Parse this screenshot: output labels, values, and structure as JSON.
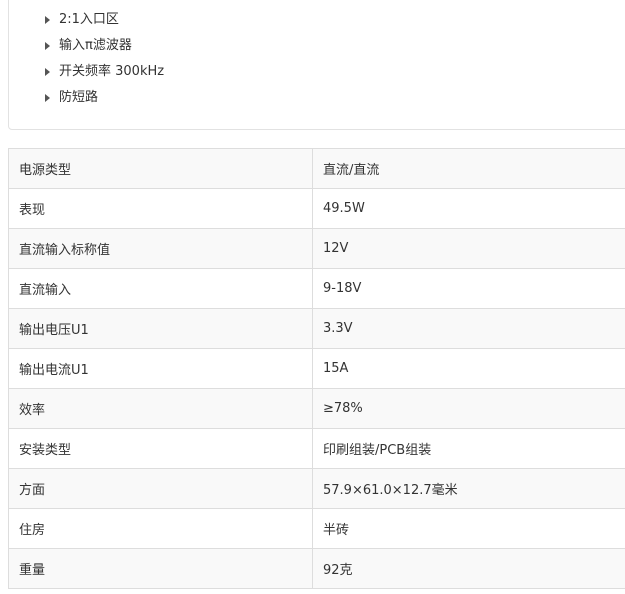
{
  "features": [
    {
      "text": "2:1入口区"
    },
    {
      "text": "输入π滤波器"
    },
    {
      "text": "开关频率 300kHz"
    },
    {
      "text": "防短路"
    }
  ],
  "specs": [
    {
      "label": "电源类型",
      "value": "直流/直流"
    },
    {
      "label": "表现",
      "value": "49.5W"
    },
    {
      "label": "直流输入标称值",
      "value": "12V"
    },
    {
      "label": "直流输入",
      "value": "9-18V"
    },
    {
      "label": "输出电压U1",
      "value": "3.3V"
    },
    {
      "label": "输出电流U1",
      "value": "15A"
    },
    {
      "label": "效率",
      "value": "≥78%"
    },
    {
      "label": "安装类型",
      "value": "印刷组装/PCB组装"
    },
    {
      "label": "方面",
      "value": "57.9×61.0×12.7毫米"
    },
    {
      "label": "住房",
      "value": "半砖"
    },
    {
      "label": "重量",
      "value": "92克"
    }
  ]
}
